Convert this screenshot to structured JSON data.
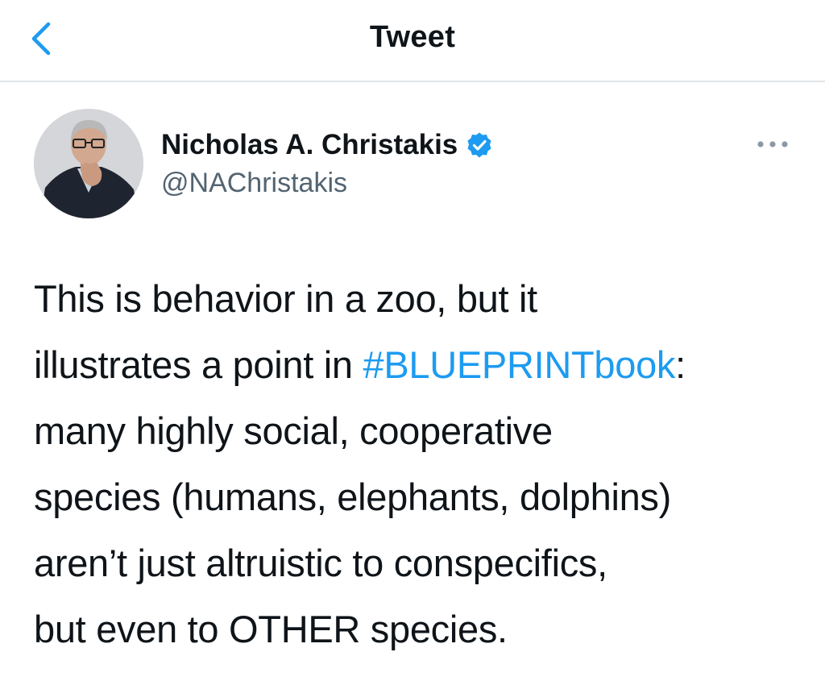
{
  "header": {
    "title": "Tweet",
    "back_icon": "chevron-left-icon"
  },
  "author": {
    "name": "Nicholas A. Christakis",
    "handle": "@NAChristakis",
    "verified_icon": "verified-badge-icon",
    "avatar": "avatar-photo"
  },
  "more_icon": "more-horizontal-icon",
  "tweet": {
    "lines": [
      {
        "text": "This is behavior in a zoo, but it"
      },
      {
        "before": "illustrates a point in ",
        "hashtag": "#BLUEPRINTbook",
        "after": ":"
      },
      {
        "text": "many highly social, cooperative"
      },
      {
        "text": "species (humans, elephants, dolphins)"
      },
      {
        "text": "aren’t just altruistic to conspecifics,"
      },
      {
        "text": "but even to OTHER species."
      }
    ]
  },
  "colors": {
    "accent": "#1d9bf0",
    "text": "#0f1419",
    "secondary_text": "#536471",
    "divider": "#e1e4e8"
  }
}
